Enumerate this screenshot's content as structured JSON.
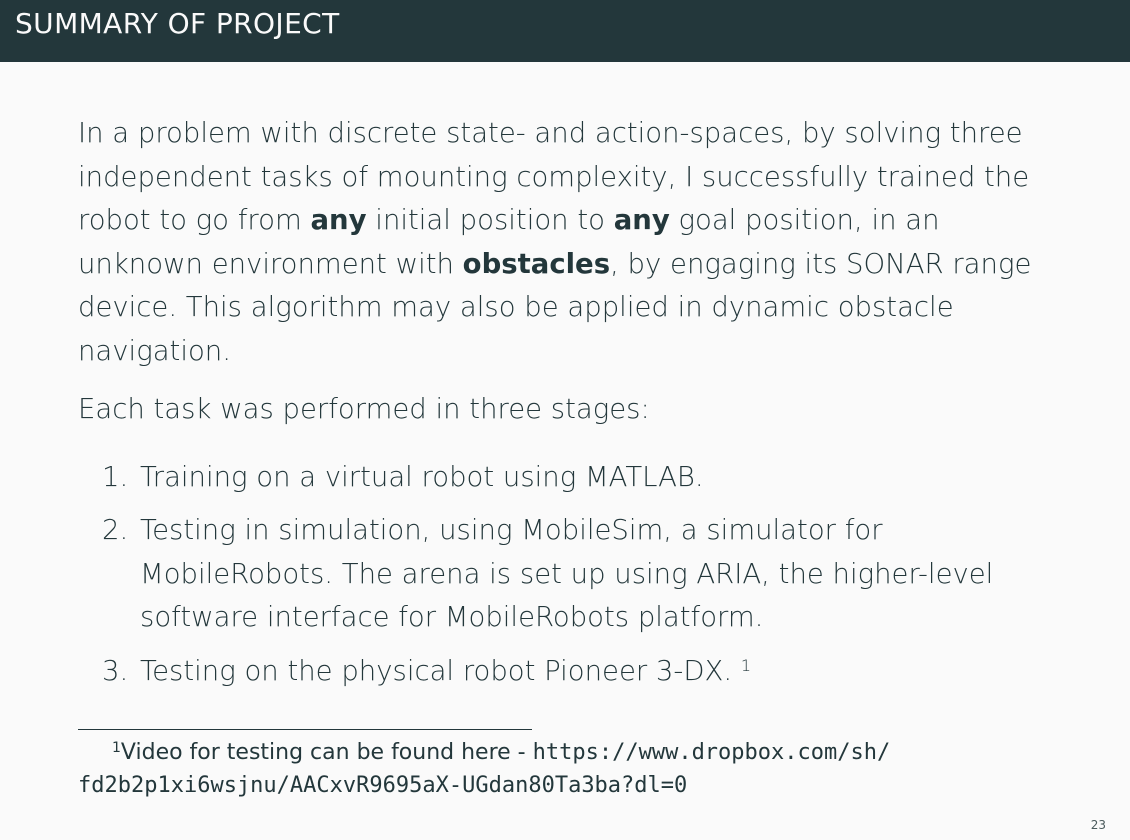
{
  "header": {
    "title": "SUMMARY OF PROJECT"
  },
  "summary": {
    "p1_a": "In a problem with discrete state- and action-spaces, by solving three independent tasks of mounting complexity, I successfully trained the robot to go from ",
    "p1_bold1": "any",
    "p1_b": " initial position to ",
    "p1_bold2": "any",
    "p1_c": " goal position, in an unknown environment with ",
    "p1_bold3": "obstacles",
    "p1_d": ", by engaging its SONAR range device. This algorithm may also be applied in dynamic obstacle navigation.",
    "p2": "Each task was performed in three stages:"
  },
  "stages": [
    {
      "num": "1.",
      "text": "Training on a virtual robot using MATLAB."
    },
    {
      "num": "2.",
      "text": "Testing in simulation, using MobileSim, a simulator for MobileRobots. The arena is set up using ARIA, the higher-level software interface for MobileRobots platform."
    },
    {
      "num": "3.",
      "text": "Testing on the physical robot Pioneer 3-DX.",
      "footnote_ref": "1"
    }
  ],
  "footnote": {
    "mark": "1",
    "text": "Video for testing can be found here - ",
    "url_part1": "https://www.dropbox.com/sh/",
    "url_part2": "fd2b2p1xi6wsjnu/AACxvR9695aX-UGdan80Ta3ba?dl=0"
  },
  "page_number": "23",
  "colors": {
    "header_bg": "#23373b",
    "background": "#fafafa",
    "text": "#23373b"
  }
}
